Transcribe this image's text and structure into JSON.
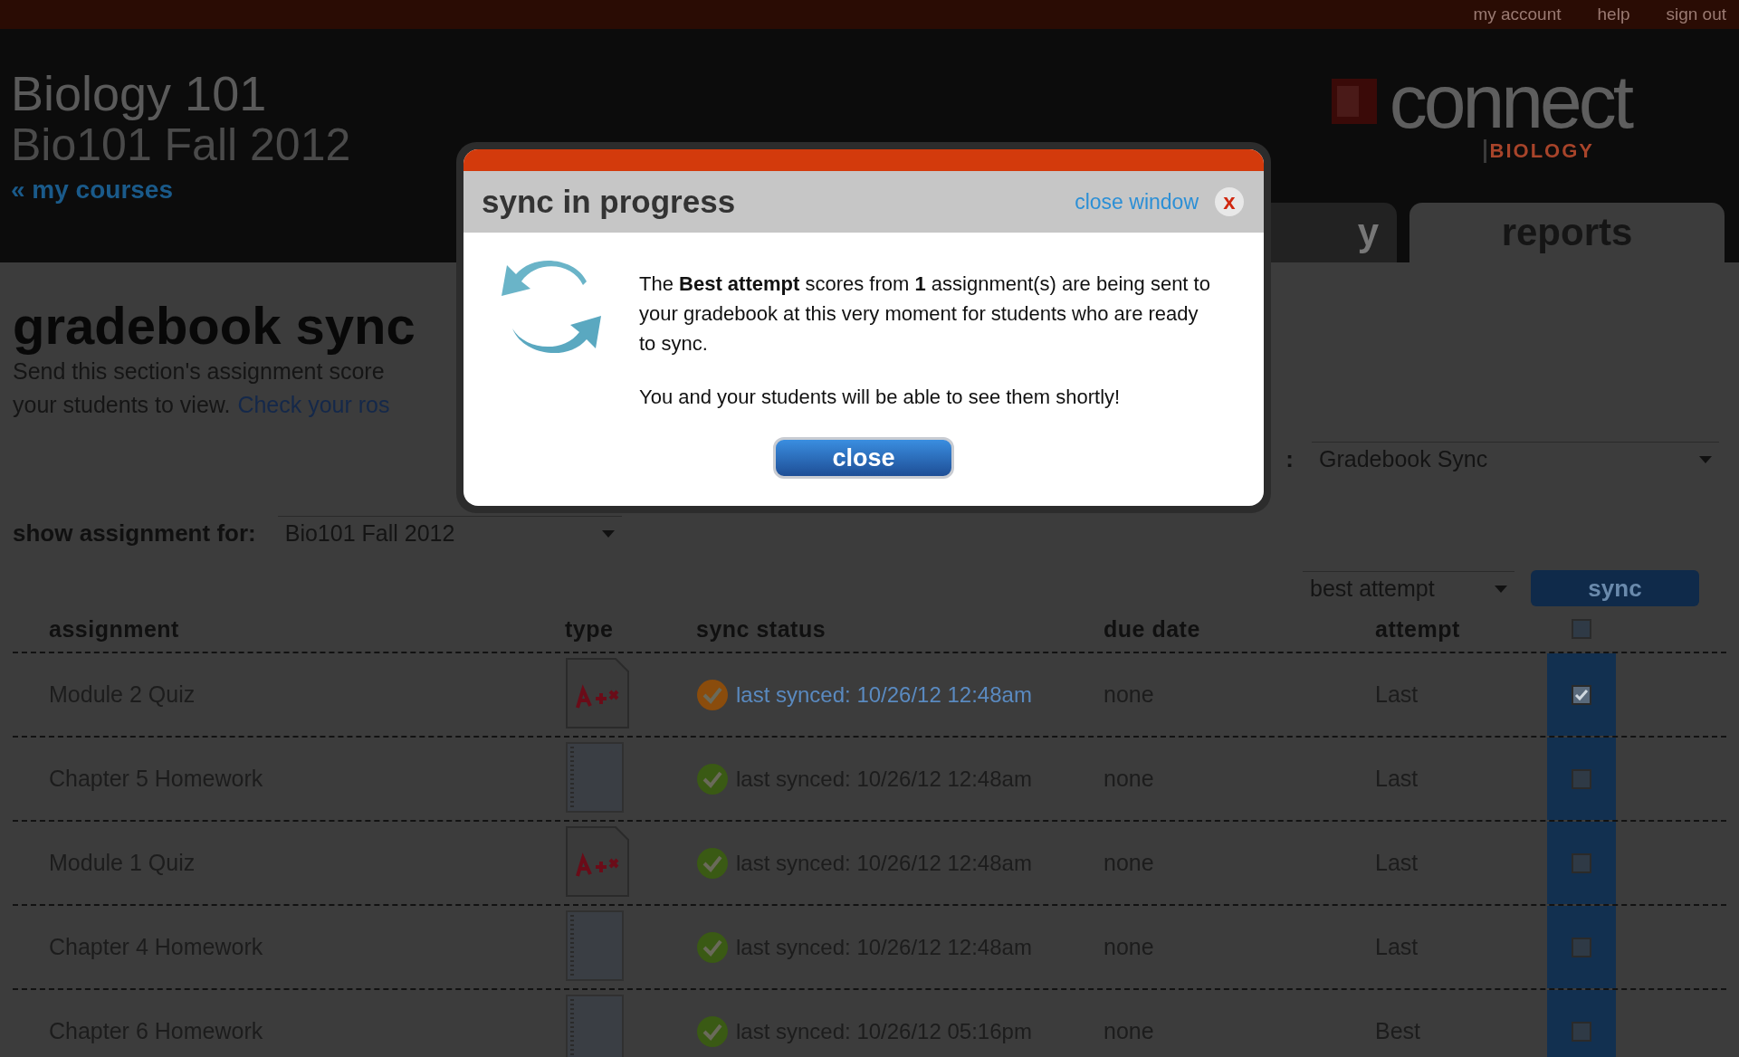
{
  "top_links": [
    "my account",
    "help",
    "sign out"
  ],
  "header": {
    "course": "Biology 101",
    "section": "Bio101 Fall 2012",
    "back_link": "« my courses",
    "logo_word": "connect",
    "logo_subject": "BIOLOGY"
  },
  "tabs": [
    {
      "label": "y",
      "selected": false
    },
    {
      "label": "reports",
      "selected": true
    }
  ],
  "page": {
    "title": "gradebook sync",
    "description": [
      "Send this section's assignment score",
      "your students to view."
    ],
    "description_link": "Check your ros",
    "view_label": ":",
    "view_select": "Gradebook Sync",
    "show_label": "show assignment for:",
    "show_select": "Bio101 Fall 2012",
    "attempt_select": "best attempt",
    "sync_button": "sync"
  },
  "table": {
    "columns": [
      "assignment",
      "type",
      "sync status",
      "due date",
      "attempt"
    ],
    "select_all_checked": false,
    "rows": [
      {
        "assignment": "Module 2 Quiz",
        "kind": "quiz",
        "color": "#8a4c0c",
        "sync_status": "last synced: 10/26/12 12:48am",
        "due_date": "none",
        "attempt": "Last",
        "checked": true
      },
      {
        "assignment": "Chapter 5 Homework",
        "kind": "homework",
        "color": "#3a5a14",
        "sync_status": "last synced: 10/26/12 12:48am",
        "due_date": "none",
        "attempt": "Last",
        "checked": false
      },
      {
        "assignment": "Module 1 Quiz",
        "kind": "quiz",
        "color": "#3a5a14",
        "sync_status": "last synced: 10/26/12 12:48am",
        "due_date": "none",
        "attempt": "Last",
        "checked": false
      },
      {
        "assignment": "Chapter 4 Homework",
        "kind": "homework",
        "color": "#3a5a14",
        "sync_status": "last synced: 10/26/12 12:48am",
        "due_date": "none",
        "attempt": "Last",
        "checked": false
      },
      {
        "assignment": "Chapter 6 Homework",
        "kind": "homework",
        "color": "#3a5a14",
        "sync_status": "last synced: 10/26/12 05:16pm",
        "due_date": "none",
        "attempt": "Best",
        "checked": false
      }
    ]
  },
  "dialog": {
    "title": "sync in progress",
    "close_link": "close window",
    "close_x": "x",
    "message": "The **Best attempt** scores from **1** assignment(s) are being sent to your gradebook at this very moment for students who are ready to sync.",
    "note": "You and your students will be able to see them shortly!",
    "button": "close"
  }
}
